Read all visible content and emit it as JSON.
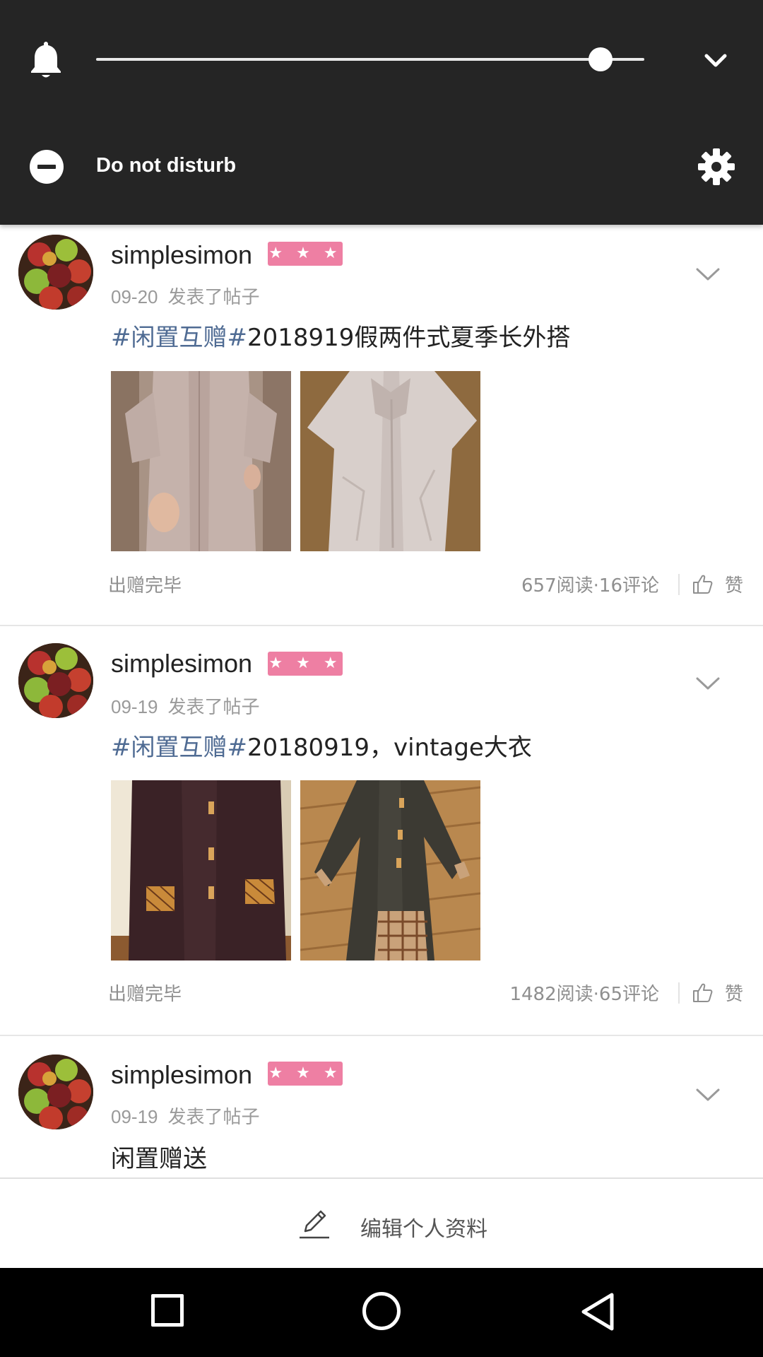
{
  "notification_shade": {
    "volume_level": 0.92,
    "dnd_label": "Do not disturb"
  },
  "posts": [
    {
      "username": "simplesimon",
      "badge": "★ ★ ★",
      "date": "09-20",
      "action": "发表了帖子",
      "title_tag": "#闲置互赠#",
      "title_text": "2018919假两件式夏季长外搭",
      "status": "出赠完毕",
      "stats": "657阅读·16评论",
      "like_label": "赞"
    },
    {
      "username": "simplesimon",
      "badge": "★ ★ ★",
      "date": "09-19",
      "action": "发表了帖子",
      "title_tag": "#闲置互赠#",
      "title_text": "20180919，vintage大衣",
      "status": "出赠完毕",
      "stats": "1482阅读·65评论",
      "like_label": "赞"
    },
    {
      "username": "simplesimon",
      "badge": "★ ★ ★",
      "date": "09-19",
      "action": "发表了帖子",
      "title_text": "闲置赠送"
    }
  ],
  "edit_profile": {
    "label": "编辑个人资料"
  },
  "colors": {
    "shade_bg": "#252525",
    "badge": "#ee7fa3",
    "hashtag": "#4f6b93",
    "muted_text": "#9a9a9a"
  }
}
